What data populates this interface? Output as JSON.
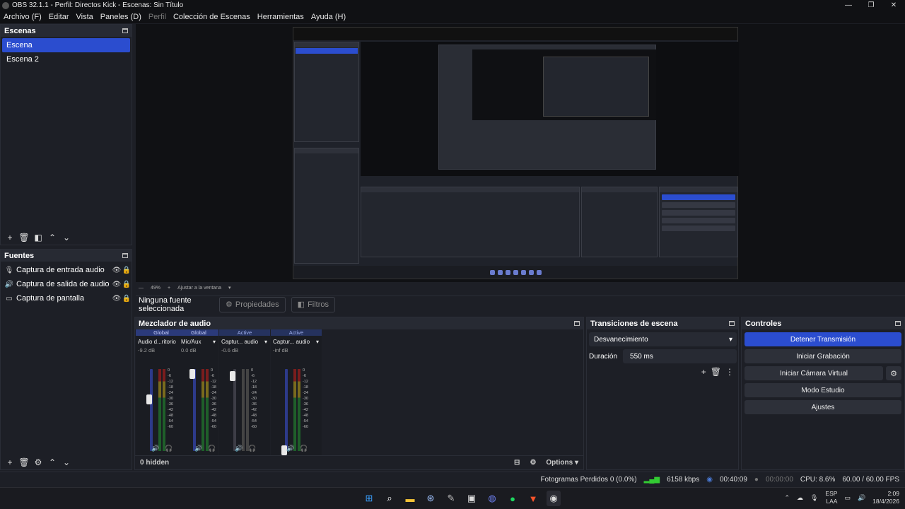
{
  "window": {
    "title": "OBS 32.1.1 - Perfil: Directos Kick - Escenas: Sin Título",
    "controls": [
      "—",
      "❐",
      "✕"
    ]
  },
  "menu": [
    {
      "label": "Archivo (F)",
      "enabled": true
    },
    {
      "label": "Editar",
      "enabled": true
    },
    {
      "label": "Vista",
      "enabled": true
    },
    {
      "label": "Paneles (D)",
      "enabled": true
    },
    {
      "label": "Perfil",
      "enabled": false
    },
    {
      "label": "Colección de Escenas",
      "enabled": true
    },
    {
      "label": "Herramientas",
      "enabled": true
    },
    {
      "label": "Ayuda (H)",
      "enabled": true
    }
  ],
  "scenes": {
    "title": "Escenas",
    "items": [
      {
        "label": "Escena",
        "selected": true
      },
      {
        "label": "Escena 2",
        "selected": false
      }
    ]
  },
  "sources": {
    "title": "Fuentes",
    "items": [
      {
        "label": "Captura de entrada audio",
        "icon": "microphone-icon"
      },
      {
        "label": "Captura de salida de audio",
        "icon": "speaker-icon"
      },
      {
        "label": "Captura de pantalla",
        "icon": "monitor-icon"
      }
    ]
  },
  "preview": {
    "zoom": "49%",
    "fit_label": "Ajustar a la ventana"
  },
  "source_bar": {
    "no_selection": "Ninguna fuente seleccionada",
    "properties": "Propiedades",
    "filters": "Filtros"
  },
  "mixer": {
    "title": "Mezclador de audio",
    "scale": [
      "0",
      "-6",
      "-12",
      "-18",
      "-24",
      "-30",
      "-36",
      "-42",
      "-48",
      "-54",
      "-60"
    ],
    "channels": [
      {
        "tag": "Global",
        "name": "Audio d...ritorio",
        "db": "-9.2 dB",
        "fader_level": 0.67,
        "muted": false
      },
      {
        "tag": "Global",
        "name": "Mic/Aux",
        "db": "0.0 dB",
        "fader_level": 1.0,
        "muted": false
      },
      {
        "tag": "Active",
        "name": "Captur... audio",
        "db": "-0.6 dB",
        "fader_level": 0.97,
        "muted": true
      },
      {
        "tag": "Active",
        "name": "Captur... audio",
        "db": "-inf dB",
        "fader_level": 0.0,
        "muted": false
      }
    ],
    "hidden": "0 hidden",
    "options": "Options"
  },
  "transitions": {
    "title": "Transiciones de escena",
    "selected": "Desvanecimiento",
    "duration_label": "Duración",
    "duration_value": "550 ms"
  },
  "controls": {
    "title": "Controles",
    "buttons": [
      "Detener Transmisión",
      "Iniciar Grabación",
      "Iniciar Cámara Virtual",
      "Modo Estudio",
      "Ajustes"
    ]
  },
  "status": {
    "dropped": "Fotogramas Perdidos 0 (0.0%)",
    "bitrate": "6158 kbps",
    "stream_time": "00:40:09",
    "rec_time": "00:00:00",
    "cpu": "CPU: 8.6%",
    "fps": "60.00 / 60.00 FPS"
  },
  "taskbar": {
    "lang_top": "ESP",
    "lang_bottom": "LAA",
    "time": "2:09",
    "date": "18/4/2026"
  },
  "colors": {
    "accent": "#2b4dcf",
    "bg": "#1d1f26",
    "header": "#272a33"
  }
}
